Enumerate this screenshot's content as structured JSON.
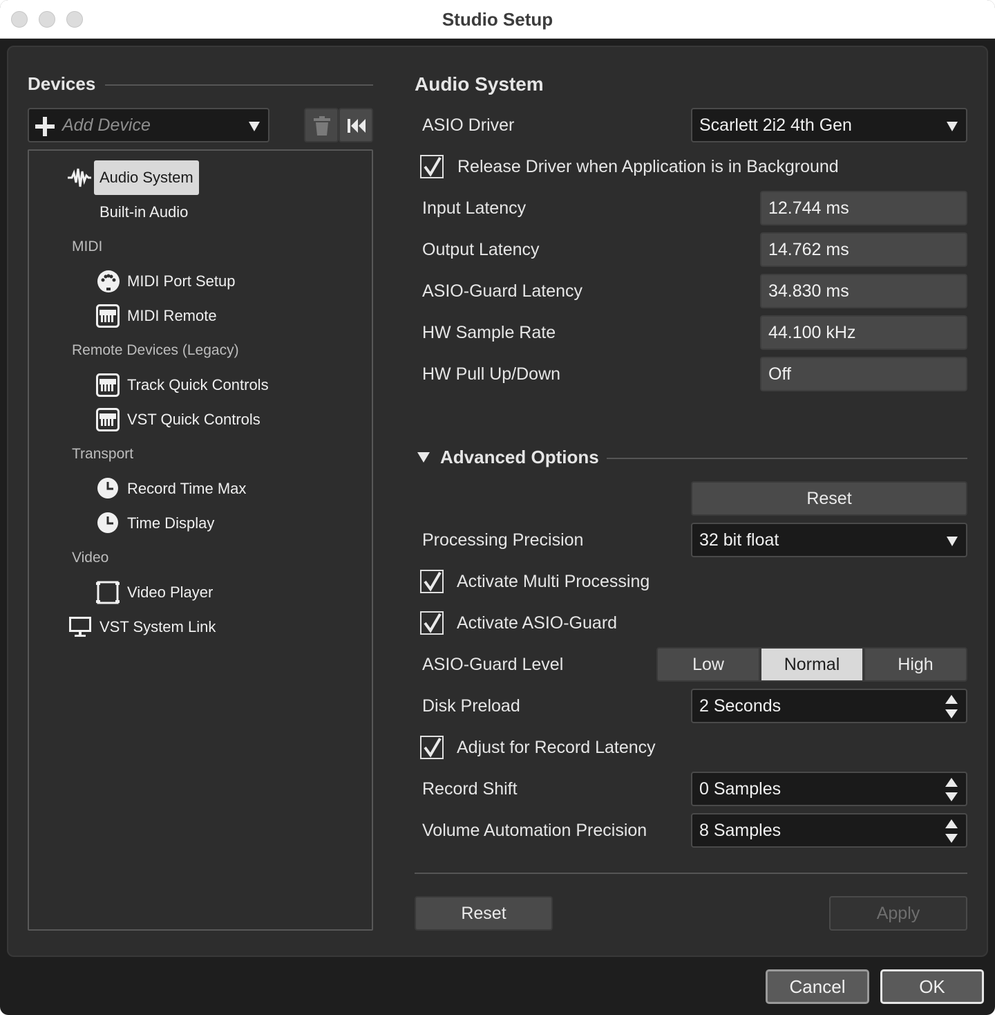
{
  "window": {
    "title": "Studio Setup"
  },
  "devices_panel": {
    "title": "Devices",
    "add_device_placeholder": "Add Device",
    "tree": {
      "audio_system": "Audio System",
      "built_in_audio": "Built-in Audio",
      "midi_category": "MIDI",
      "midi_port_setup": "MIDI Port Setup",
      "midi_remote": "MIDI Remote",
      "remote_category": "Remote Devices (Legacy)",
      "track_quick_controls": "Track Quick Controls",
      "vst_quick_controls": "VST Quick Controls",
      "transport_category": "Transport",
      "record_time_max": "Record Time Max",
      "time_display": "Time Display",
      "video_category": "Video",
      "video_player": "Video Player",
      "vst_system_link": "VST System Link"
    }
  },
  "audio_system": {
    "title": "Audio System",
    "asio_driver_label": "ASIO Driver",
    "asio_driver_value": "Scarlett 2i2 4th Gen",
    "release_driver_label": "Release Driver when Application is in Background",
    "release_driver_checked": true,
    "input_latency_label": "Input Latency",
    "input_latency_value": "12.744 ms",
    "output_latency_label": "Output Latency",
    "output_latency_value": "14.762 ms",
    "asio_guard_latency_label": "ASIO-Guard Latency",
    "asio_guard_latency_value": "34.830 ms",
    "hw_sample_rate_label": "HW Sample Rate",
    "hw_sample_rate_value": "44.100 kHz",
    "hw_pull_label": "HW Pull Up/Down",
    "hw_pull_value": "Off"
  },
  "advanced": {
    "title": "Advanced Options",
    "reset_label": "Reset",
    "processing_precision_label": "Processing Precision",
    "processing_precision_value": "32 bit float",
    "multi_processing_label": "Activate Multi Processing",
    "multi_processing_checked": true,
    "asio_guard_label": "Activate ASIO-Guard",
    "asio_guard_checked": true,
    "asio_guard_level_label": "ASIO-Guard Level",
    "levels": [
      "Low",
      "Normal",
      "High"
    ],
    "selected_level": "Normal",
    "disk_preload_label": "Disk Preload",
    "disk_preload_value": "2 Seconds",
    "adjust_record_label": "Adjust for Record Latency",
    "adjust_record_checked": true,
    "record_shift_label": "Record Shift",
    "record_shift_value": "0 Samples",
    "volume_auto_label": "Volume Automation Precision",
    "volume_auto_value": "8 Samples"
  },
  "panel_buttons": {
    "reset": "Reset",
    "apply": "Apply"
  },
  "footer": {
    "cancel": "Cancel",
    "ok": "OK"
  },
  "colors": {
    "background": "#2d2d2d",
    "selected_item": "#d9d9d9",
    "field_bg": "#1a1a1a",
    "value_bg": "#484848"
  }
}
